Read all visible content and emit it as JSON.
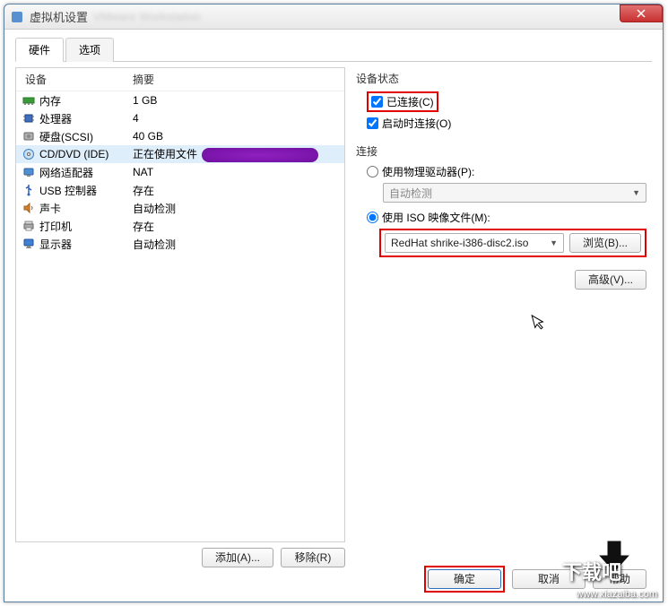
{
  "window": {
    "title": "虚拟机设置"
  },
  "tabs": {
    "hardware": "硬件",
    "options": "选项"
  },
  "device_list": {
    "header_device": "设备",
    "header_summary": "摘要",
    "rows": [
      {
        "icon": "memory-icon",
        "name": "内存",
        "summary": "1 GB"
      },
      {
        "icon": "cpu-icon",
        "name": "处理器",
        "summary": "4"
      },
      {
        "icon": "disk-icon",
        "name": "硬盘(SCSI)",
        "summary": "40 GB"
      },
      {
        "icon": "cd-icon",
        "name": "CD/DVD (IDE)",
        "summary": "正在使用文件"
      },
      {
        "icon": "network-icon",
        "name": "网络适配器",
        "summary": "NAT"
      },
      {
        "icon": "usb-icon",
        "name": "USB 控制器",
        "summary": "存在"
      },
      {
        "icon": "sound-icon",
        "name": "声卡",
        "summary": "自动检测"
      },
      {
        "icon": "printer-icon",
        "name": "打印机",
        "summary": "存在"
      },
      {
        "icon": "display-icon",
        "name": "显示器",
        "summary": "自动检测"
      }
    ],
    "selected_index": 3,
    "add_btn": "添加(A)...",
    "remove_btn": "移除(R)"
  },
  "status_group": {
    "title": "设备状态",
    "connected": "已连接(C)",
    "connect_at_power": "启动时连接(O)"
  },
  "connection_group": {
    "title": "连接",
    "use_physical": "使用物理驱动器(P):",
    "physical_value": "自动检测",
    "use_iso": "使用 ISO 映像文件(M):",
    "iso_value": "RedHat shrike-i386-disc2.iso",
    "browse_btn": "浏览(B)..."
  },
  "advanced_btn": "高级(V)...",
  "footer": {
    "ok": "确定",
    "cancel": "取消",
    "help": "帮助"
  },
  "watermark": {
    "cn": "下载吧",
    "url": "www.xiazaiba.com"
  }
}
